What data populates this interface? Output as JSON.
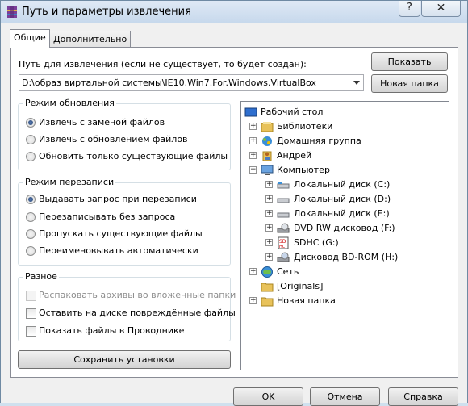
{
  "window": {
    "title": "Путь и параметры извлечения"
  },
  "titlebar": {
    "help_label": "?",
    "close_label": "✕"
  },
  "tabs": [
    {
      "label": "Общие",
      "active": true
    },
    {
      "label": "Дополнительно",
      "active": false
    }
  ],
  "path": {
    "label": "Путь для извлечения (если не существует, то будет создан):",
    "value": "D:\\образ виртальной системы\\IE10.Win7.For.Windows.VirtualBox"
  },
  "buttons": {
    "show": "Показать",
    "new_folder": "Новая папка",
    "save_settings": "Сохранить установки",
    "ok": "OK",
    "cancel": "Отмена",
    "help": "Справка"
  },
  "update_mode": {
    "title": "Режим обновления",
    "options": [
      {
        "label": "Извлечь с заменой файлов",
        "checked": true
      },
      {
        "label": "Извлечь с обновлением файлов",
        "checked": false
      },
      {
        "label": "Обновить только существующие файлы",
        "checked": false
      }
    ]
  },
  "overwrite_mode": {
    "title": "Режим перезаписи",
    "options": [
      {
        "label": "Выдавать запрос при перезаписи",
        "checked": true
      },
      {
        "label": "Перезаписывать без запроса",
        "checked": false
      },
      {
        "label": "Пропускать существующие файлы",
        "checked": false
      },
      {
        "label": "Переименовывать автоматически",
        "checked": false
      }
    ]
  },
  "misc": {
    "title": "Разное",
    "options": [
      {
        "label": "Распаковать архивы во вложенные папки",
        "checked": false,
        "disabled": true
      },
      {
        "label": "Оставить на диске повреждённые файлы",
        "checked": false,
        "disabled": false
      },
      {
        "label": "Показать файлы в Проводнике",
        "checked": false,
        "disabled": false
      }
    ]
  },
  "tree": {
    "items": [
      {
        "label": "Рабочий стол",
        "icon": "desktop-icon"
      },
      {
        "label": "Библиотеки",
        "icon": "libraries-icon"
      },
      {
        "label": "Домашняя группа",
        "icon": "homegroup-icon"
      },
      {
        "label": "Андрей",
        "icon": "user-icon"
      },
      {
        "label": "Компьютер",
        "icon": "computer-icon"
      },
      {
        "label": "Локальный диск (C:)",
        "icon": "drive-icon"
      },
      {
        "label": "Локальный диск (D:)",
        "icon": "drive-icon"
      },
      {
        "label": "Локальный диск (E:)",
        "icon": "drive-icon"
      },
      {
        "label": "DVD RW дисковод (F:)",
        "icon": "dvd-icon"
      },
      {
        "label": "SDHC (G:)",
        "icon": "sd-card-icon"
      },
      {
        "label": "Дисковод BD-ROM (H:)",
        "icon": "bd-rom-icon"
      },
      {
        "label": "Сеть",
        "icon": "network-icon"
      },
      {
        "label": "[Originals]",
        "icon": "folder-icon"
      },
      {
        "label": "Новая папка",
        "icon": "folder-icon"
      }
    ]
  },
  "colors": {
    "folder": "#e8c25a",
    "desktop": "#2f6fcf",
    "network": "#3a8fd8"
  }
}
